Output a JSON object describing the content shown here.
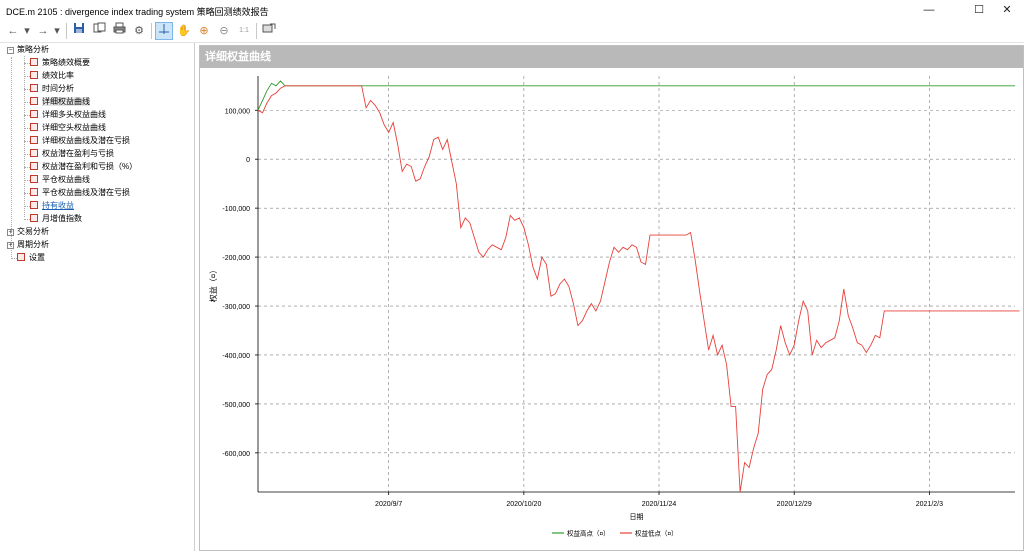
{
  "window": {
    "title": "DCE.m 2105 : divergence index trading system 策略回测绩效报告",
    "controls": {
      "minimize": "—",
      "maximize": "☐",
      "close": "✕"
    }
  },
  "toolbar": {
    "icons": [
      "back-icon",
      "forward-icon",
      "dropdown-icon",
      "save-icon",
      "copy-icon",
      "print-icon",
      "settings-icon",
      "crosshair-icon",
      "pan-hand-icon",
      "zoom-in-icon",
      "zoom-out-icon",
      "zoom-reset-icon",
      "export-icon"
    ],
    "zoom_reset_label": "1:1"
  },
  "tree": {
    "groups": [
      {
        "label": "策略分析",
        "expanded": true,
        "items": [
          "策略绩效概要",
          "绩效比率",
          "时间分析",
          "详细权益曲线",
          "详细多头权益曲线",
          "详细空头权益曲线",
          "详细权益曲线及潜在亏损",
          "权益潜在盈利与亏损",
          "权益潜在盈利和亏损（%）",
          "平仓权益曲线",
          "平仓权益曲线及潜在亏损",
          "持有收益",
          "月增值指数"
        ],
        "selected": "详细权益曲线",
        "hovered": "持有收益"
      },
      {
        "label": "交易分析",
        "expanded": false
      },
      {
        "label": "周期分析",
        "expanded": false
      }
    ],
    "settings_label": "设置"
  },
  "panel": {
    "title": "详细权益曲线"
  },
  "chart_data": {
    "type": "line",
    "ylabel": "权益（¤）",
    "xlabel": "日期",
    "ylim": [
      -680000,
      170000
    ],
    "yticks": [
      100000,
      0,
      -100000,
      -200000,
      -300000,
      -400000,
      -500000,
      -600000
    ],
    "ytick_labels": [
      "100,000",
      "0",
      "-100,000",
      "-200,000",
      "-300,000",
      "-400,000",
      "-500,000",
      "-600,000"
    ],
    "x_tick_labels": [
      "2020/9/7",
      "2020/10/20",
      "2020/11/24",
      "2020/12/29",
      "2021/2/3"
    ],
    "x_tick_indices": [
      29,
      59,
      89,
      119,
      149
    ],
    "n_points": 169,
    "grid": true,
    "legend_position": "bottom",
    "series": [
      {
        "name": "权益高点（¤）",
        "color": "#2e9c2e",
        "values": [
          100000,
          120000,
          140000,
          155000,
          150000,
          160000,
          150000,
          150000,
          150000,
          150000,
          150000,
          150000,
          150000,
          150000,
          150000,
          150000,
          150000,
          150000,
          150000,
          150000,
          150000,
          150000,
          150000,
          150000,
          150000,
          150000,
          150000,
          150000,
          150000,
          150000,
          150000,
          150000,
          150000,
          150000,
          150000,
          150000,
          150000,
          150000,
          150000,
          150000,
          150000,
          150000,
          150000,
          150000,
          150000,
          150000,
          150000,
          150000,
          150000,
          150000,
          150000,
          150000,
          150000,
          150000,
          150000,
          150000,
          150000,
          150000,
          150000,
          150000,
          150000,
          150000,
          150000,
          150000,
          150000,
          150000,
          150000,
          150000,
          150000,
          150000,
          150000,
          150000,
          150000,
          150000,
          150000,
          150000,
          150000,
          150000,
          150000,
          150000,
          150000,
          150000,
          150000,
          150000,
          150000,
          150000,
          150000,
          150000,
          150000,
          150000,
          150000,
          150000,
          150000,
          150000,
          150000,
          150000,
          150000,
          150000,
          150000,
          150000,
          150000,
          150000,
          150000,
          150000,
          150000,
          150000,
          150000,
          150000,
          150000,
          150000,
          150000,
          150000,
          150000,
          150000,
          150000,
          150000,
          150000,
          150000,
          150000,
          150000,
          150000,
          150000,
          150000,
          150000,
          150000,
          150000,
          150000,
          150000,
          150000,
          150000,
          150000,
          150000,
          150000,
          150000,
          150000,
          150000,
          150000,
          150000,
          150000,
          150000,
          150000,
          150000,
          150000,
          150000,
          150000,
          150000,
          150000,
          150000,
          150000,
          150000,
          150000,
          150000,
          150000,
          150000,
          150000,
          150000,
          150000,
          150000,
          150000,
          150000,
          150000,
          150000,
          150000,
          150000,
          150000,
          150000,
          150000,
          150000,
          150000
        ]
      },
      {
        "name": "权益低点（¤）",
        "color": "#e8403a",
        "values": [
          100000,
          95000,
          115000,
          130000,
          135000,
          145000,
          150000,
          150000,
          150000,
          150000,
          150000,
          150000,
          150000,
          150000,
          150000,
          150000,
          150000,
          150000,
          150000,
          150000,
          150000,
          150000,
          150000,
          150000,
          105000,
          120000,
          110000,
          95000,
          70000,
          55000,
          75000,
          30000,
          -25000,
          -10000,
          -15000,
          -45000,
          -40000,
          -15000,
          5000,
          40000,
          45000,
          20000,
          40000,
          -5000,
          -50000,
          -140000,
          -120000,
          -130000,
          -160000,
          -190000,
          -200000,
          -185000,
          -175000,
          -180000,
          -185000,
          -160000,
          -115000,
          -125000,
          -120000,
          -140000,
          -175000,
          -220000,
          -245000,
          -200000,
          -215000,
          -280000,
          -275000,
          -255000,
          -245000,
          -260000,
          -295000,
          -340000,
          -330000,
          -310000,
          -295000,
          -310000,
          -290000,
          -250000,
          -210000,
          -180000,
          -190000,
          -180000,
          -185000,
          -175000,
          -180000,
          -210000,
          -215000,
          -155000,
          -155000,
          -155000,
          -155000,
          -155000,
          -155000,
          -155000,
          -155000,
          -155000,
          -150000,
          -205000,
          -270000,
          -330000,
          -390000,
          -360000,
          -400000,
          -380000,
          -420000,
          -505000,
          -505000,
          -680000,
          -620000,
          -630000,
          -590000,
          -560000,
          -470000,
          -440000,
          -430000,
          -390000,
          -340000,
          -375000,
          -400000,
          -380000,
          -330000,
          -290000,
          -310000,
          -400000,
          -370000,
          -385000,
          -375000,
          -370000,
          -365000,
          -330000,
          -265000,
          -320000,
          -345000,
          -375000,
          -380000,
          -395000,
          -380000,
          -360000,
          -365000,
          -310000,
          -310000,
          -310000,
          -310000,
          -310000,
          -310000,
          -310000,
          -310000,
          -310000,
          -310000,
          -310000,
          -310000,
          -310000,
          -310000,
          -310000,
          -310000,
          -310000,
          -310000,
          -310000,
          -310000,
          -310000,
          -310000,
          -310000,
          -310000,
          -310000,
          -310000,
          -310000,
          -310000,
          -310000,
          -310000,
          -310000
        ]
      }
    ]
  }
}
